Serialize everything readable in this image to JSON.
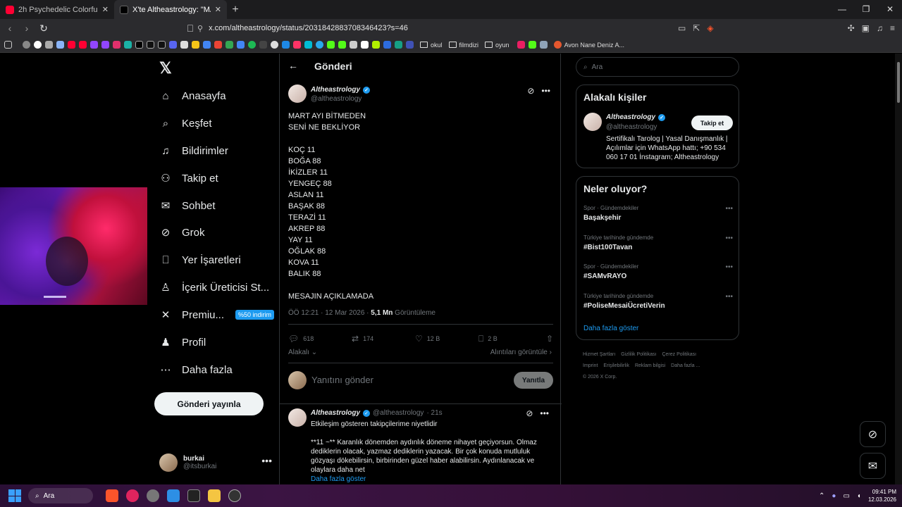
{
  "browser": {
    "tabs": [
      {
        "title": "2h Psychedelic Colorful Neon Backg",
        "fav": "#ff0033"
      },
      {
        "title": "X'te Altheastrology: \"MART AYI",
        "fav": "#000000"
      }
    ],
    "url": "x.com/altheastrology/status/2031842883708346423?s=46",
    "bookmarks_folders": [
      "okul",
      "filmdizi",
      "oyun"
    ],
    "bookmark_extra": "Avon Nane Deniz A..."
  },
  "nav": {
    "items": [
      {
        "label": "Anasayfa",
        "icon": "home-icon",
        "glyph": "⌂"
      },
      {
        "label": "Keşfet",
        "icon": "search-icon",
        "glyph": "⌕"
      },
      {
        "label": "Bildirimler",
        "icon": "bell-icon",
        "glyph": "♫"
      },
      {
        "label": "Takip et",
        "icon": "follow-icon",
        "glyph": "⚇"
      },
      {
        "label": "Sohbet",
        "icon": "chat-icon",
        "glyph": "✉"
      },
      {
        "label": "Grok",
        "icon": "grok-icon",
        "glyph": "⊘"
      },
      {
        "label": "Yer İşaretleri",
        "icon": "bookmark-icon",
        "glyph": "⎕"
      },
      {
        "label": "İçerik Üreticisi St...",
        "icon": "creator-icon",
        "glyph": "♙"
      },
      {
        "label": "Premiu...",
        "icon": "x-premium-icon",
        "glyph": "✕"
      },
      {
        "label": "Profil",
        "icon": "profile-icon",
        "glyph": "♟"
      },
      {
        "label": "Daha fazla",
        "icon": "more-icon",
        "glyph": "⋯"
      }
    ],
    "promo_badge": "%50 indirim",
    "post_button": "Gönderi yayınla",
    "account_name": "burkai",
    "account_handle": "@itsburkai"
  },
  "post": {
    "page_title": "Gönderi",
    "author": "Altheastrology",
    "handle": "@altheastrology",
    "body": "MART AYI BİTMEDEN\nSENİ NE BEKLİYOR\n\nKOÇ 11\nBOĞA 88\nİKİZLER 11\nYENGEÇ 88\nASLAN 11\nBAŞAK 88\nTERAZİ 11\nAKREP 88\nYAY 11\nOĞLAK 88\nKOVA 11\nBALIK 88\n\nMESAJIN AÇIKLAMADA",
    "time": "ÖÖ 12:21 · 12 Mar 2026 · ",
    "views": "5,1 Mn",
    "views_label": " Görüntüleme",
    "replies": "618",
    "reposts": "174",
    "likes": "12 B",
    "bookmarks": "2 B",
    "relevance": "Alakalı",
    "quotes": "Alıntıları görüntüle",
    "reply_placeholder": "Yanıtını gönder",
    "reply_button": "Yanıtla"
  },
  "reply": {
    "author": "Altheastrology",
    "handle": "@altheastrology",
    "age": "· 21s",
    "intro": "Etkileşim gösteren takipçilerime niyetlidir",
    "body": "**11 ~** Karanlık dönemden aydınlık döneme nihayet geçiyorsun. Olmaz dediklerin olacak, yazmaz dediklerin yazacak. Bir çok konuda mutluluk gözyaşı dökebilirsin, birbirinden güzel haber alabilirsin. Aydınlanacak ve olaylara daha net",
    "more": "Daha fazla göster"
  },
  "sidebar": {
    "search_placeholder": "Ara",
    "related_title": "Alakalı kişiler",
    "related_name": "Altheastrology",
    "related_handle": "@altheastrology",
    "follow": "Takip et",
    "related_bio": "Sertifikalı Tarolog | Yasal Danışmanlık | Açılımlar için WhatsApp hattı; +90 534 060 17 01 İnstagram; Altheastrology",
    "trends_title": "Neler oluyor?",
    "trends": [
      {
        "cat": "Spor · Gündemdekiler",
        "title": "Başakşehir"
      },
      {
        "cat": "Türkiye tarihinde gündemde",
        "title": "#Bist100Tavan"
      },
      {
        "cat": "Spor · Gündemdekiler",
        "title": "#SAMvRAYO"
      },
      {
        "cat": "Türkiye tarihinde gündemde",
        "title": "#PoliseMesaiÜcretiVerin"
      }
    ],
    "show_more": "Daha fazla göster",
    "footer": [
      "Hizmet Şartları",
      "Gizlilik Politikası",
      "Çerez Politikası",
      "Imprint",
      "Erişilebilirlik",
      "Reklam bilgisi",
      "Daha fazla ...",
      "© 2026 X Corp."
    ]
  },
  "taskbar": {
    "search": "Ara",
    "time": "09:41 PM",
    "date": "12.03.2026"
  },
  "colors": {
    "accent": "#1d9bf0",
    "bg": "#000000",
    "border": "#2f3336"
  }
}
